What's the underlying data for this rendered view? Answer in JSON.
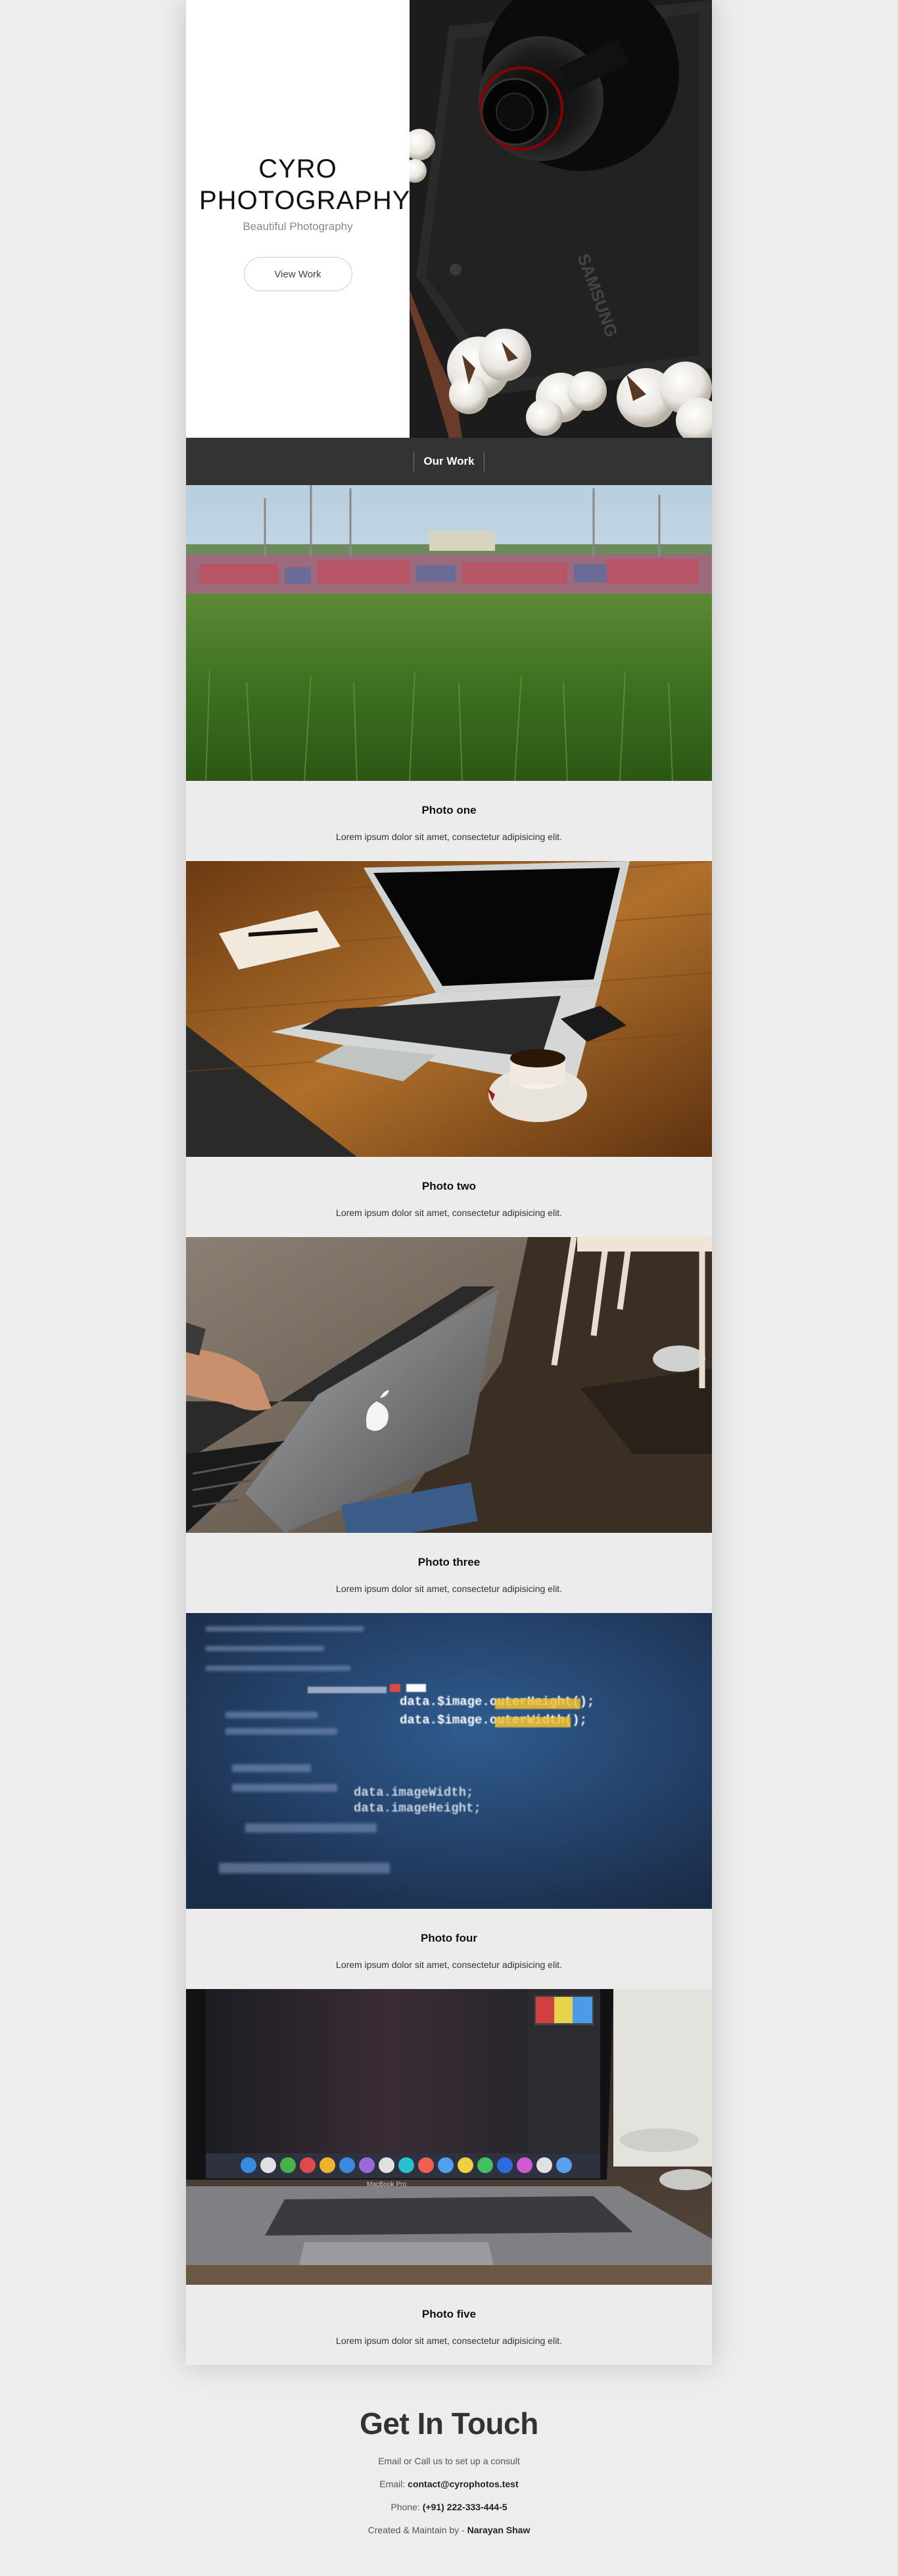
{
  "hero": {
    "brand": "CYRO PHOTOGRAPHY",
    "tagline": "Beautiful Photography",
    "cta_label": "View Work",
    "camera_brand": "SAMSUNG"
  },
  "nav": {
    "items": [
      {
        "label": "Our Work"
      }
    ]
  },
  "gallery": [
    {
      "title": "Photo one",
      "text": "Lorem ipsum dolor sit amet, consectetur adipisicing elit."
    },
    {
      "title": "Photo two",
      "text": "Lorem ipsum dolor sit amet, consectetur adipisicing elit."
    },
    {
      "title": "Photo three",
      "text": "Lorem ipsum dolor sit amet, consectetur adipisicing elit."
    },
    {
      "title": "Photo four",
      "text": "Lorem ipsum dolor sit amet, consectetur adipisicing elit."
    },
    {
      "title": "Photo five",
      "text": "Lorem ipsum dolor sit amet, consectetur adipisicing elit."
    }
  ],
  "photo_four_code": {
    "line1": "data.$image.outerHeight();",
    "line2": "data.$image.outerWidth();",
    "line3": "data.imageWidth;",
    "line4": "data.imageHeight;"
  },
  "laptop_label": "MacBook Pro",
  "footer": {
    "title": "Get In Touch",
    "subtitle": "Email or Call us to set up a consult",
    "email_label": "Email:",
    "email_value": "contact@cyrophotos.test",
    "phone_label": "Phone:",
    "phone_value": "(+91) 222-333-444-5",
    "credit_label": "Created & Maintain by -",
    "credit_value": "Narayan Shaw"
  },
  "colors": {
    "nav_bg": "#333333",
    "caption_bg": "#ececec",
    "page_bg": "#ededed"
  }
}
